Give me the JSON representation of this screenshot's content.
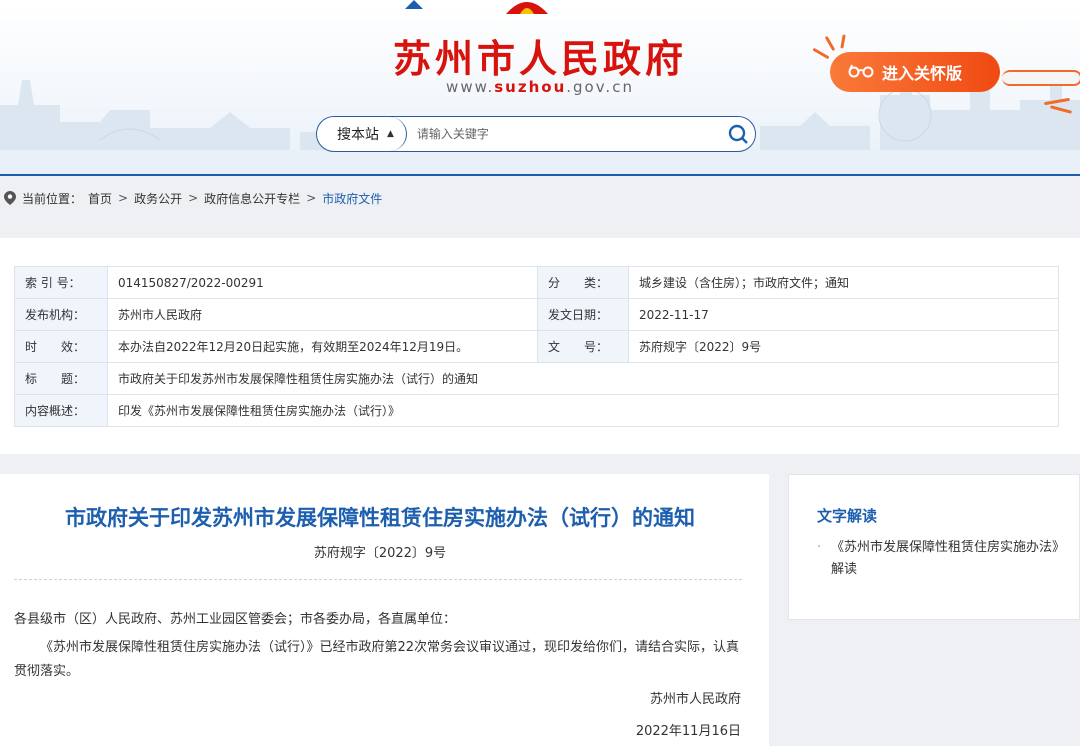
{
  "header": {
    "title": "苏州市人民政府",
    "url_prefix": "www.",
    "url_highlight": "suzhou",
    "url_suffix": ".gov.cn",
    "care_mode_label": "进入关怀版",
    "accent": "#d8120c",
    "brand_blue": "#1d5fae"
  },
  "search": {
    "scope_label": "搜本站",
    "placeholder": "请输入关键字",
    "button_icon": "search-icon"
  },
  "breadcrumb": {
    "prefix": "当前位置：",
    "items": [
      "首页",
      "政务公开",
      "政府信息公开专栏",
      "市政府文件"
    ],
    "separator": ">"
  },
  "meta": {
    "index_label": "索 引 号：",
    "index_value": "014150827/2022-00291",
    "category_label": "分　　类：",
    "category_value": "城乡建设（含住房）；市政府文件；通知",
    "publisher_label": "发布机构：",
    "publisher_value": "苏州市人民政府",
    "date_label": "发文日期：",
    "date_value": "2022-11-17",
    "validity_label": "时　　效：",
    "validity_value": "本办法自2022年12月20日起实施，有效期至2024年12月19日。",
    "docno_label": "文　　号：",
    "docno_value": "苏府规字〔2022〕9号",
    "title_label": "标　　题：",
    "title_value": "市政府关于印发苏州市发展保障性租赁住房实施办法（试行）的通知",
    "summary_label": "内容概述：",
    "summary_value": "印发《苏州市发展保障性租赁住房实施办法（试行）》"
  },
  "article": {
    "title": "市政府关于印发苏州市发展保障性租赁住房实施办法（试行）的通知",
    "doc_number": "苏府规字〔2022〕9号",
    "salutation": "各县级市（区）人民政府、苏州工业园区管委会；市各委办局，各直属单位：",
    "paragraph": "《苏州市发展保障性租赁住房实施办法（试行）》已经市政府第22次常务会议审议通过，现印发给你们，请结合实际，认真贯彻落实。",
    "signer": "苏州市人民政府",
    "sign_date": "2022年11月16日"
  },
  "sidebar": {
    "title": "文字解读",
    "items": [
      "《苏州市发展保障性租赁住房实施办法》解读"
    ]
  }
}
